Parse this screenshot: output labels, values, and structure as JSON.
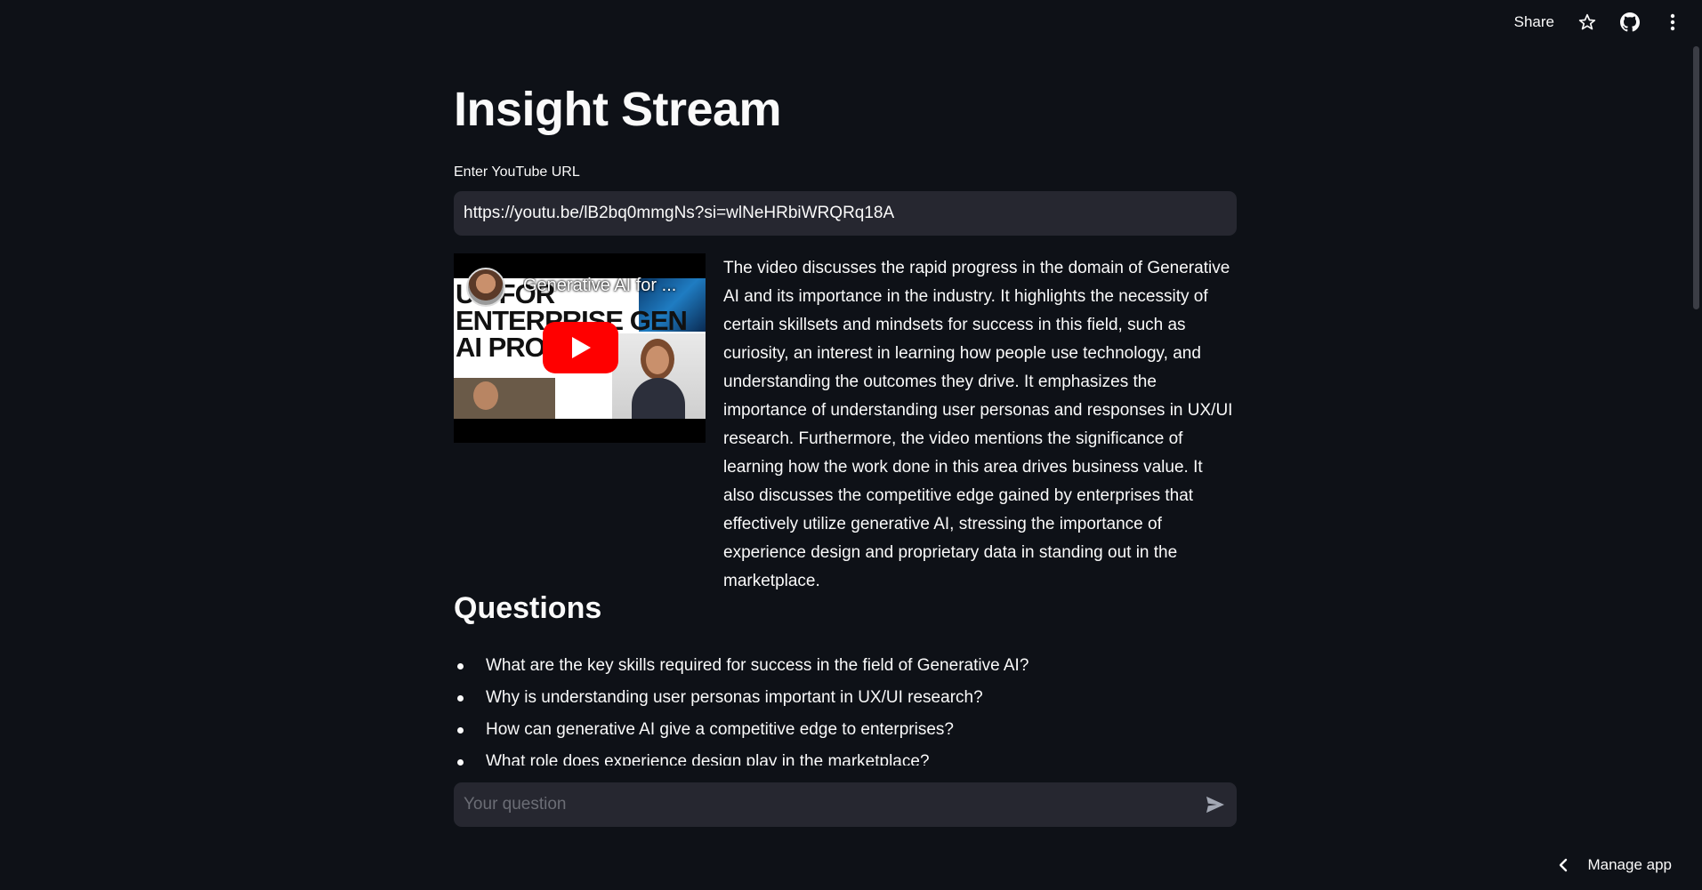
{
  "toolbar": {
    "share_label": "Share",
    "icons": [
      "star-icon",
      "github-icon",
      "more-vertical-icon"
    ]
  },
  "app": {
    "title": "Insight Stream"
  },
  "url_input": {
    "label": "Enter YouTube URL",
    "value": "https://youtu.be/lB2bq0mmgNs?si=wlNeHRbiWRQRq18A"
  },
  "video": {
    "title": "Generative AI for ...",
    "thumbnail_text": [
      "UX FOR",
      "ENTERPRISE GEN",
      "AI PROD"
    ],
    "play_color": "#ff0000"
  },
  "summary": "The video discusses the rapid progress in the domain of Generative AI and its importance in the industry. It highlights the necessity of certain skillsets and mindsets for success in this field, such as curiosity, an interest in learning how people use technology, and understanding the outcomes they drive. It emphasizes the importance of understanding user personas and responses in UX/UI research. Furthermore, the video mentions the significance of learning how the work done in this area drives business value. It also discusses the competitive edge gained by enterprises that effectively utilize generative AI, stressing the importance of experience design and proprietary data in standing out in the marketplace.",
  "questions": {
    "heading": "Questions",
    "items": [
      "What are the key skills required for success in the field of Generative AI?",
      "Why is understanding user personas important in UX/UI research?",
      "How can generative AI give a competitive edge to enterprises?",
      "What role does experience design play in the marketplace?"
    ]
  },
  "chat": {
    "placeholder": "Your question"
  },
  "footer": {
    "manage_label": "Manage app"
  },
  "colors": {
    "background": "#0e1117",
    "input_bg": "#262730",
    "text": "#fafafa"
  }
}
